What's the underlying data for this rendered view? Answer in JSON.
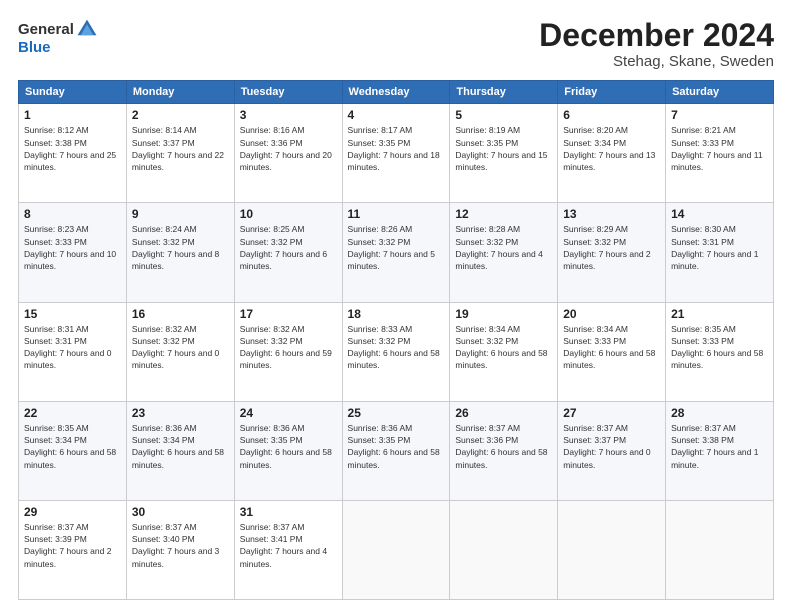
{
  "header": {
    "logo_general": "General",
    "logo_blue": "Blue",
    "month": "December 2024",
    "location": "Stehag, Skane, Sweden"
  },
  "days_of_week": [
    "Sunday",
    "Monday",
    "Tuesday",
    "Wednesday",
    "Thursday",
    "Friday",
    "Saturday"
  ],
  "weeks": [
    [
      {
        "day": "1",
        "sunrise": "Sunrise: 8:12 AM",
        "sunset": "Sunset: 3:38 PM",
        "daylight": "Daylight: 7 hours and 25 minutes."
      },
      {
        "day": "2",
        "sunrise": "Sunrise: 8:14 AM",
        "sunset": "Sunset: 3:37 PM",
        "daylight": "Daylight: 7 hours and 22 minutes."
      },
      {
        "day": "3",
        "sunrise": "Sunrise: 8:16 AM",
        "sunset": "Sunset: 3:36 PM",
        "daylight": "Daylight: 7 hours and 20 minutes."
      },
      {
        "day": "4",
        "sunrise": "Sunrise: 8:17 AM",
        "sunset": "Sunset: 3:35 PM",
        "daylight": "Daylight: 7 hours and 18 minutes."
      },
      {
        "day": "5",
        "sunrise": "Sunrise: 8:19 AM",
        "sunset": "Sunset: 3:35 PM",
        "daylight": "Daylight: 7 hours and 15 minutes."
      },
      {
        "day": "6",
        "sunrise": "Sunrise: 8:20 AM",
        "sunset": "Sunset: 3:34 PM",
        "daylight": "Daylight: 7 hours and 13 minutes."
      },
      {
        "day": "7",
        "sunrise": "Sunrise: 8:21 AM",
        "sunset": "Sunset: 3:33 PM",
        "daylight": "Daylight: 7 hours and 11 minutes."
      }
    ],
    [
      {
        "day": "8",
        "sunrise": "Sunrise: 8:23 AM",
        "sunset": "Sunset: 3:33 PM",
        "daylight": "Daylight: 7 hours and 10 minutes."
      },
      {
        "day": "9",
        "sunrise": "Sunrise: 8:24 AM",
        "sunset": "Sunset: 3:32 PM",
        "daylight": "Daylight: 7 hours and 8 minutes."
      },
      {
        "day": "10",
        "sunrise": "Sunrise: 8:25 AM",
        "sunset": "Sunset: 3:32 PM",
        "daylight": "Daylight: 7 hours and 6 minutes."
      },
      {
        "day": "11",
        "sunrise": "Sunrise: 8:26 AM",
        "sunset": "Sunset: 3:32 PM",
        "daylight": "Daylight: 7 hours and 5 minutes."
      },
      {
        "day": "12",
        "sunrise": "Sunrise: 8:28 AM",
        "sunset": "Sunset: 3:32 PM",
        "daylight": "Daylight: 7 hours and 4 minutes."
      },
      {
        "day": "13",
        "sunrise": "Sunrise: 8:29 AM",
        "sunset": "Sunset: 3:32 PM",
        "daylight": "Daylight: 7 hours and 2 minutes."
      },
      {
        "day": "14",
        "sunrise": "Sunrise: 8:30 AM",
        "sunset": "Sunset: 3:31 PM",
        "daylight": "Daylight: 7 hours and 1 minute."
      }
    ],
    [
      {
        "day": "15",
        "sunrise": "Sunrise: 8:31 AM",
        "sunset": "Sunset: 3:31 PM",
        "daylight": "Daylight: 7 hours and 0 minutes."
      },
      {
        "day": "16",
        "sunrise": "Sunrise: 8:32 AM",
        "sunset": "Sunset: 3:32 PM",
        "daylight": "Daylight: 7 hours and 0 minutes."
      },
      {
        "day": "17",
        "sunrise": "Sunrise: 8:32 AM",
        "sunset": "Sunset: 3:32 PM",
        "daylight": "Daylight: 6 hours and 59 minutes."
      },
      {
        "day": "18",
        "sunrise": "Sunrise: 8:33 AM",
        "sunset": "Sunset: 3:32 PM",
        "daylight": "Daylight: 6 hours and 58 minutes."
      },
      {
        "day": "19",
        "sunrise": "Sunrise: 8:34 AM",
        "sunset": "Sunset: 3:32 PM",
        "daylight": "Daylight: 6 hours and 58 minutes."
      },
      {
        "day": "20",
        "sunrise": "Sunrise: 8:34 AM",
        "sunset": "Sunset: 3:33 PM",
        "daylight": "Daylight: 6 hours and 58 minutes."
      },
      {
        "day": "21",
        "sunrise": "Sunrise: 8:35 AM",
        "sunset": "Sunset: 3:33 PM",
        "daylight": "Daylight: 6 hours and 58 minutes."
      }
    ],
    [
      {
        "day": "22",
        "sunrise": "Sunrise: 8:35 AM",
        "sunset": "Sunset: 3:34 PM",
        "daylight": "Daylight: 6 hours and 58 minutes."
      },
      {
        "day": "23",
        "sunrise": "Sunrise: 8:36 AM",
        "sunset": "Sunset: 3:34 PM",
        "daylight": "Daylight: 6 hours and 58 minutes."
      },
      {
        "day": "24",
        "sunrise": "Sunrise: 8:36 AM",
        "sunset": "Sunset: 3:35 PM",
        "daylight": "Daylight: 6 hours and 58 minutes."
      },
      {
        "day": "25",
        "sunrise": "Sunrise: 8:36 AM",
        "sunset": "Sunset: 3:35 PM",
        "daylight": "Daylight: 6 hours and 58 minutes."
      },
      {
        "day": "26",
        "sunrise": "Sunrise: 8:37 AM",
        "sunset": "Sunset: 3:36 PM",
        "daylight": "Daylight: 6 hours and 58 minutes."
      },
      {
        "day": "27",
        "sunrise": "Sunrise: 8:37 AM",
        "sunset": "Sunset: 3:37 PM",
        "daylight": "Daylight: 7 hours and 0 minutes."
      },
      {
        "day": "28",
        "sunrise": "Sunrise: 8:37 AM",
        "sunset": "Sunset: 3:38 PM",
        "daylight": "Daylight: 7 hours and 1 minute."
      }
    ],
    [
      {
        "day": "29",
        "sunrise": "Sunrise: 8:37 AM",
        "sunset": "Sunset: 3:39 PM",
        "daylight": "Daylight: 7 hours and 2 minutes."
      },
      {
        "day": "30",
        "sunrise": "Sunrise: 8:37 AM",
        "sunset": "Sunset: 3:40 PM",
        "daylight": "Daylight: 7 hours and 3 minutes."
      },
      {
        "day": "31",
        "sunrise": "Sunrise: 8:37 AM",
        "sunset": "Sunset: 3:41 PM",
        "daylight": "Daylight: 7 hours and 4 minutes."
      },
      null,
      null,
      null,
      null
    ]
  ]
}
